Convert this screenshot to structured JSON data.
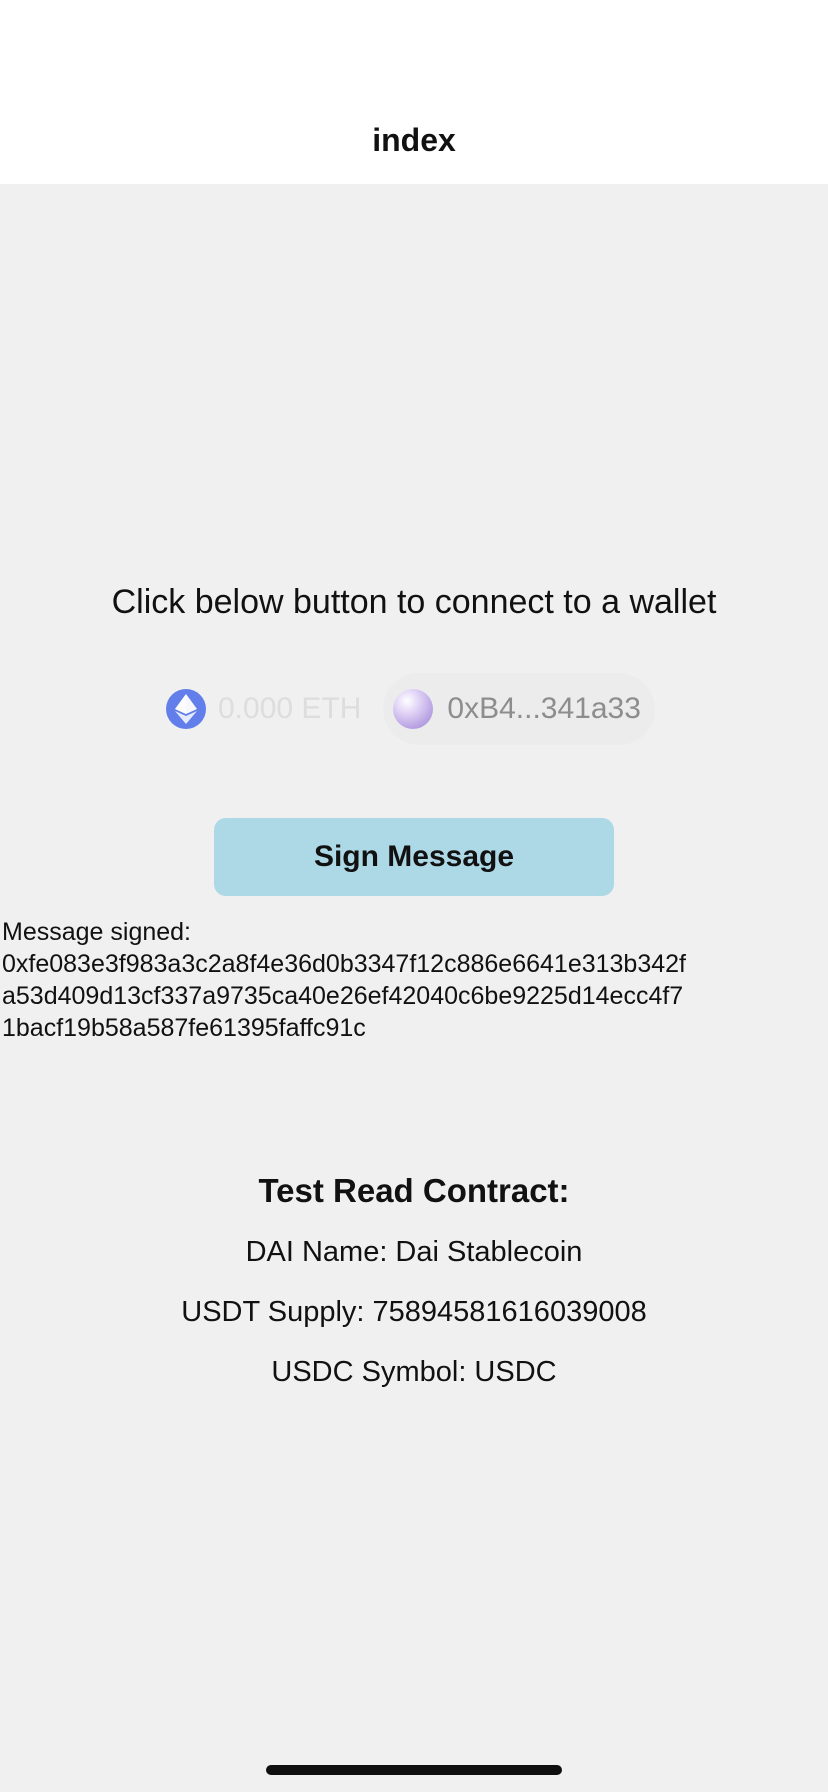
{
  "header": {
    "title": "index"
  },
  "prompt": "Click below button to connect to a wallet",
  "wallet": {
    "balance": "0.000 ETH",
    "balance_icon": "ethereum-icon",
    "address": "0xB4...341a33",
    "avatar_icon": "account-avatar"
  },
  "sign": {
    "button_label": "Sign Message",
    "result_label": "Message signed:",
    "signature_lines": [
      "0xfe083e3f983a3c2a8f4e36d0b3347f12c886e6641e313b342f",
      "a53d409d13cf337a9735ca40e26ef42040c6be9225d14ecc4f7",
      "1bacf19b58a587fe61395faffc91c"
    ]
  },
  "contract": {
    "title": "Test Read Contract:",
    "dai_name": "DAI Name: Dai Stablecoin",
    "usdt_supply": "USDT Supply: 75894581616039008",
    "usdc_symbol": "USDC Symbol: USDC"
  },
  "colors": {
    "background": "#f0f0f0",
    "header_background": "#ffffff",
    "sign_button": "#add8e6",
    "eth_icon": "#627eea"
  }
}
